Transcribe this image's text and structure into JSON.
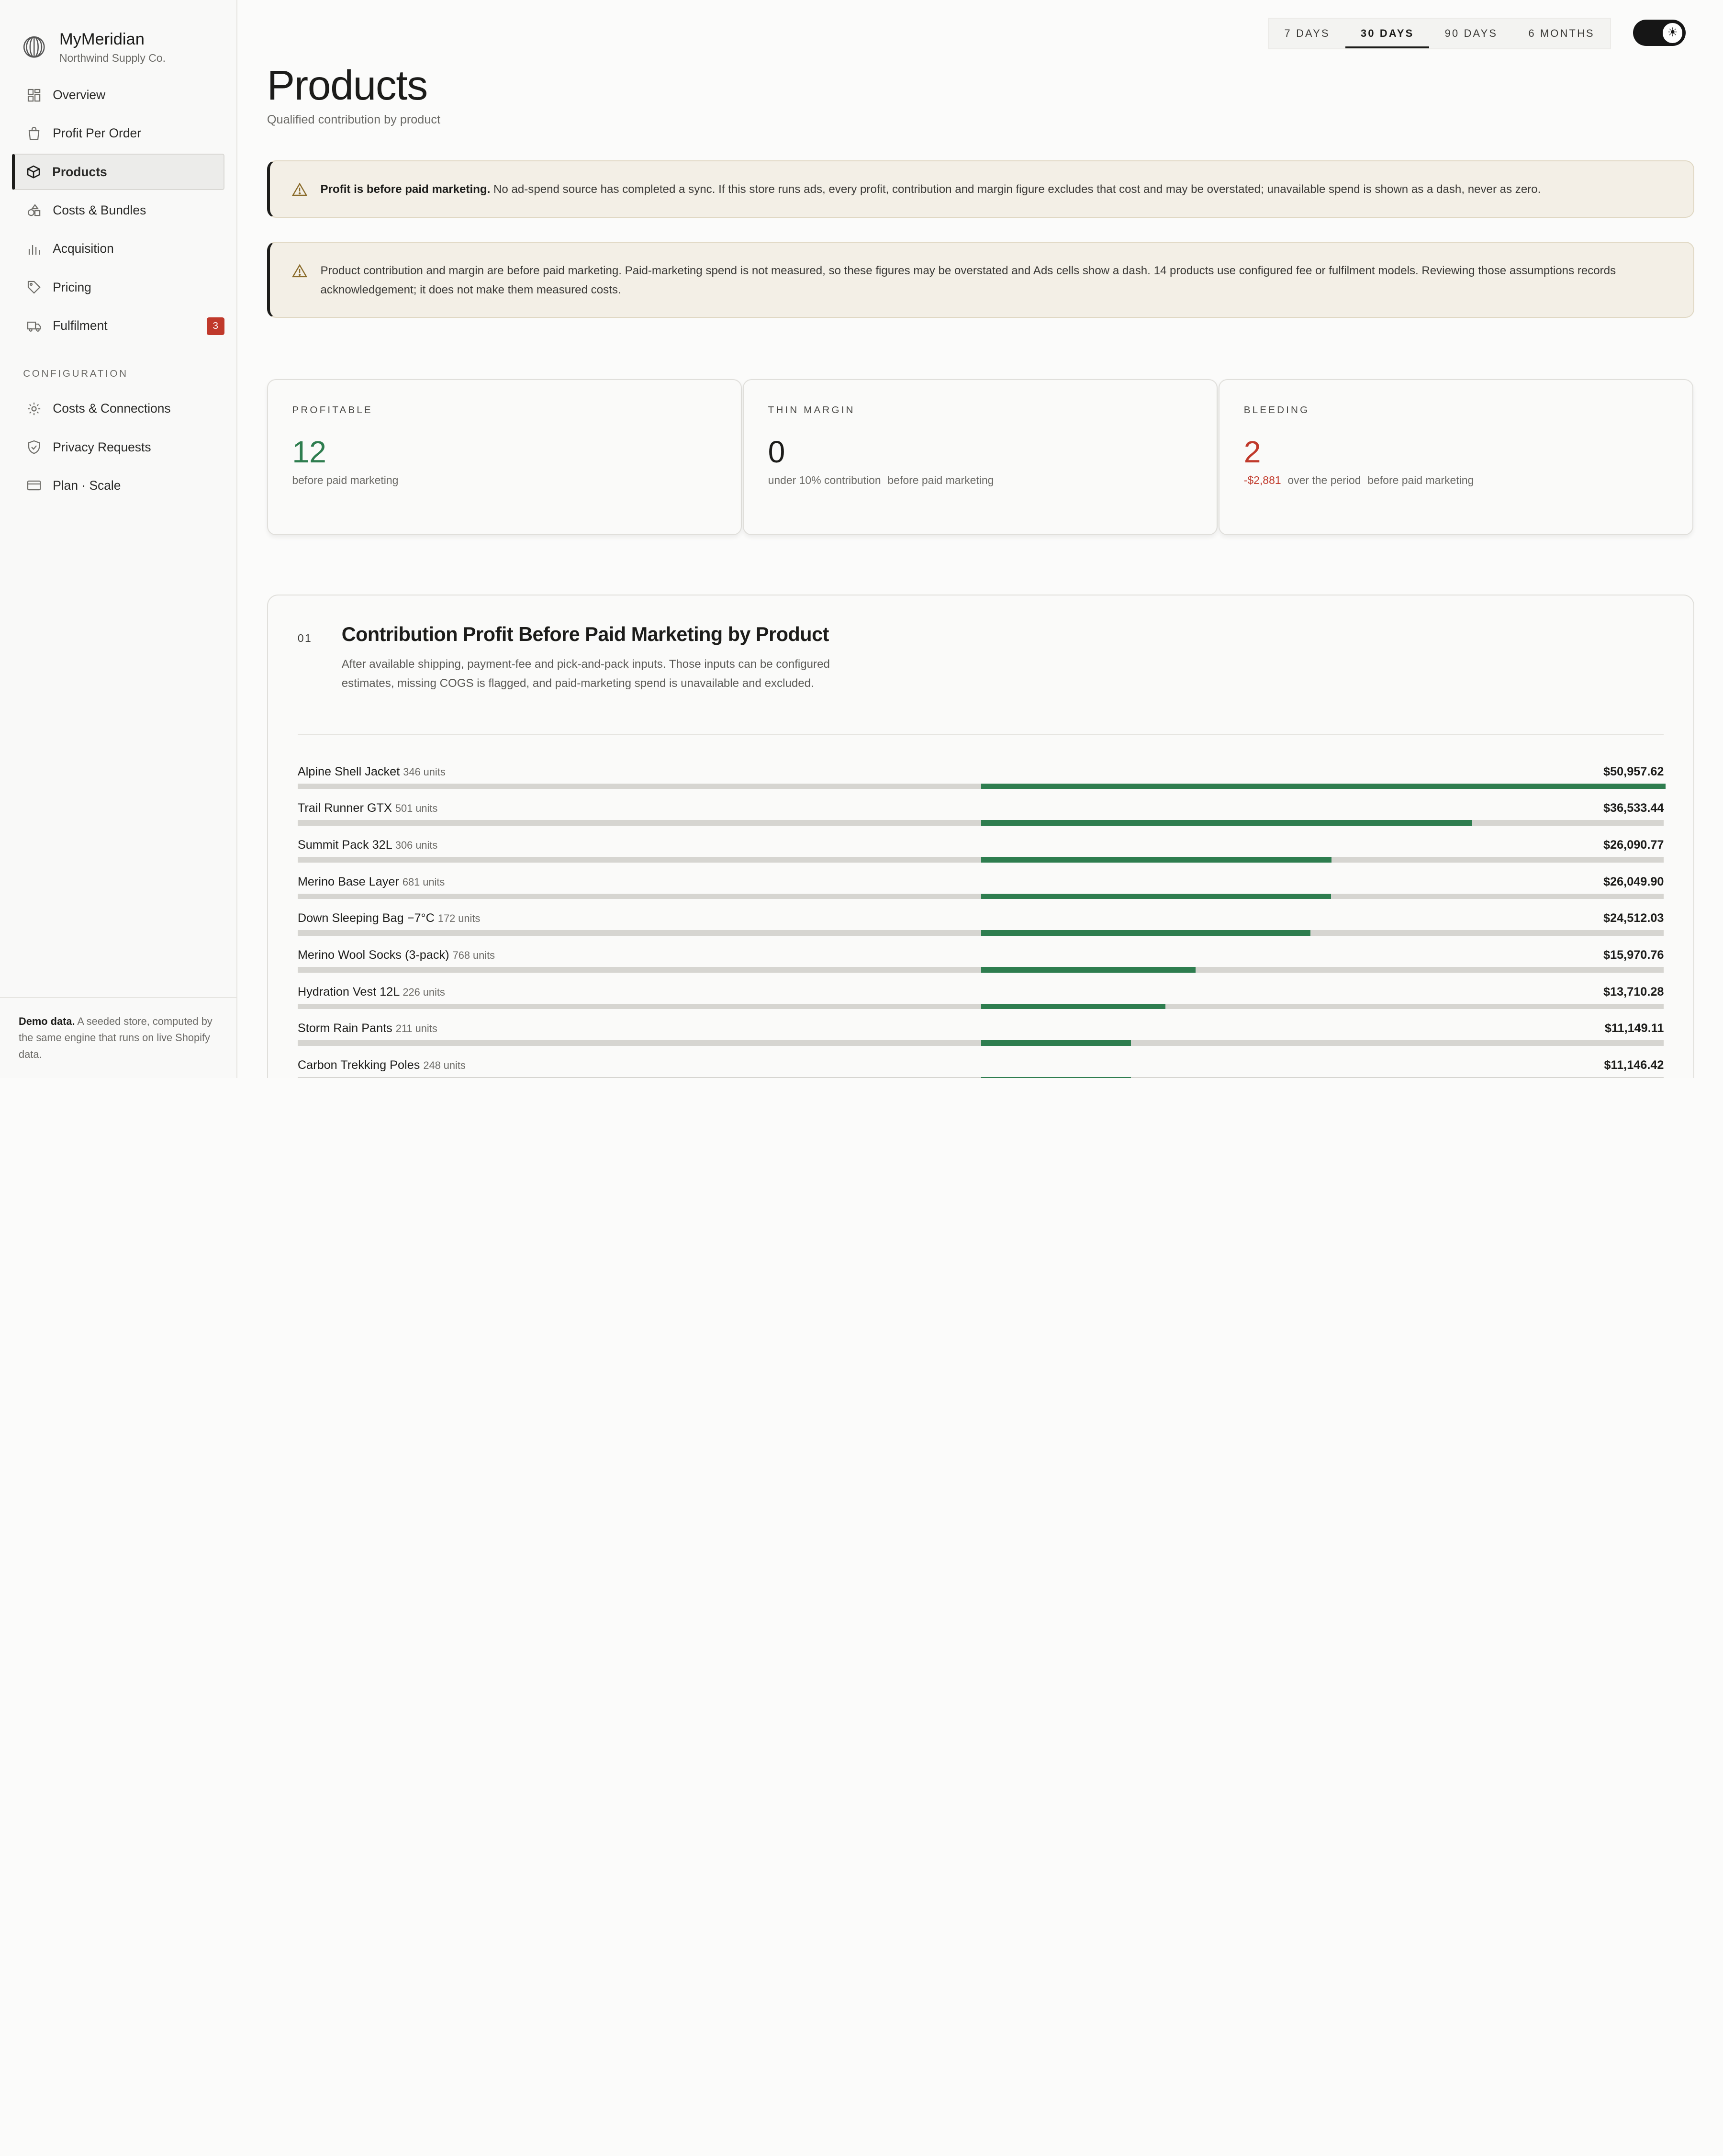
{
  "brand": {
    "name": "MyMeridian",
    "subtitle": "Northwind Supply Co."
  },
  "nav": [
    {
      "label": "Overview",
      "icon": "grid-icon"
    },
    {
      "label": "Profit Per Order",
      "icon": "bag-icon"
    },
    {
      "label": "Products",
      "icon": "box-icon",
      "active": true
    },
    {
      "label": "Costs & Bundles",
      "icon": "shapes-icon"
    },
    {
      "label": "Acquisition",
      "icon": "bar-chart-icon"
    },
    {
      "label": "Pricing",
      "icon": "tag-icon"
    },
    {
      "label": "Fulfilment",
      "icon": "truck-icon",
      "badge": "3"
    }
  ],
  "config_label": "CONFIGURATION",
  "config_nav": [
    {
      "label": "Costs & Connections",
      "icon": "gear-icon"
    },
    {
      "label": "Privacy Requests",
      "icon": "shield-icon"
    },
    {
      "label": "Plan · Scale",
      "icon": "card-icon"
    }
  ],
  "footer": {
    "bold": "Demo data.",
    "text": " A seeded store, computed by the same engine that runs on live Shopify data."
  },
  "ranges": [
    "7 DAYS",
    "30 DAYS",
    "90 DAYS",
    "6 MONTHS"
  ],
  "active_range": "30 DAYS",
  "page": {
    "title": "Products",
    "subtitle": "Qualified contribution by product"
  },
  "alert1": {
    "bold": "Profit is before paid marketing.",
    "text": " No ad-spend source has completed a sync. If this store runs ads, every profit, contribution and margin figure excludes that cost and may be overstated; unavailable spend is shown as a dash, never as zero."
  },
  "alert2": {
    "text": "Product contribution and margin are before paid marketing. Paid-marketing spend is not measured, so these figures may be overstated and Ads cells show a dash. 14 products use configured fee or fulfilment models. Reviewing those assumptions records acknowledgement; it does not make them measured costs."
  },
  "stats": {
    "profitable": {
      "label": "PROFITABLE",
      "value": "12",
      "note": "before paid marketing"
    },
    "thin": {
      "label": "THIN MARGIN",
      "value": "0",
      "note1": "under 10% contribution",
      "note2": "before paid marketing"
    },
    "bleeding": {
      "label": "BLEEDING",
      "value": "2",
      "loss": "-$2,881",
      "note1": "over the period",
      "note2": "before paid marketing"
    }
  },
  "panel": {
    "num": "01",
    "title": "Contribution Profit Before Paid Marketing by Product",
    "desc": "After available shipping, payment-fee and pick-and-pack inputs. Those inputs can be configured estimates, missing COGS is flagged, and paid-marketing spend is unavailable and excluded."
  },
  "chart_data": {
    "type": "bar",
    "max": 50957.62,
    "rows": [
      {
        "name": "Alpine Shell Jacket",
        "units": "346 units",
        "value": 50957.62,
        "amount": "$50,957.62"
      },
      {
        "name": "Trail Runner GTX",
        "units": "501 units",
        "value": 36533.44,
        "amount": "$36,533.44"
      },
      {
        "name": "Summit Pack 32L",
        "units": "306 units",
        "value": 26090.77,
        "amount": "$26,090.77"
      },
      {
        "name": "Merino Base Layer",
        "units": "681 units",
        "value": 26049.9,
        "amount": "$26,049.90"
      },
      {
        "name": "Down Sleeping Bag −7°C",
        "units": "172 units",
        "value": 24512.03,
        "amount": "$24,512.03"
      },
      {
        "name": "Merino Wool Socks (3-pack)",
        "units": "768 units",
        "value": 15970.76,
        "amount": "$15,970.76"
      },
      {
        "name": "Hydration Vest 12L",
        "units": "226 units",
        "value": 13710.28,
        "amount": "$13,710.28"
      },
      {
        "name": "Storm Rain Pants",
        "units": "211 units",
        "value": 11149.11,
        "amount": "$11,149.11"
      },
      {
        "name": "Carbon Trekking Poles",
        "units": "248 units",
        "value": 11146.42,
        "amount": "$11,146.42"
      }
    ]
  },
  "colors": {
    "accent": "#2e7d4f",
    "negative": "#c0392b",
    "alert_bg": "#f3efe6"
  }
}
